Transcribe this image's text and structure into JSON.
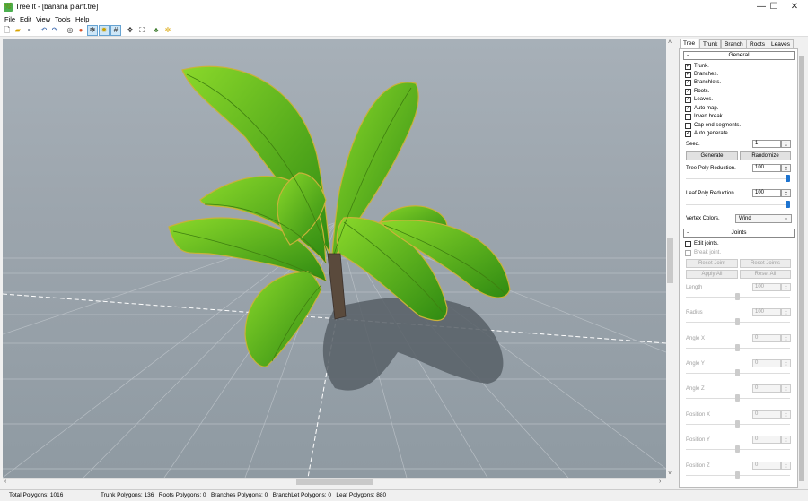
{
  "window": {
    "title": "Tree It - [banana plant.tre]",
    "icon_label": "🌿",
    "minimize": "—",
    "maximize": "☐",
    "close": "✕"
  },
  "menu": [
    "File",
    "Edit",
    "View",
    "Tools",
    "Help"
  ],
  "toolbar": [
    "new-icon",
    "open-icon",
    "save-icon",
    "undo-icon",
    "redo-icon",
    "wireframe-icon",
    "color-icon",
    "texture-icon",
    "light-icon",
    "grid-icon",
    "move-icon",
    "zoom-extents-icon",
    "tree-icon",
    "settings-icon"
  ],
  "tabs": [
    "Tree",
    "Trunk",
    "Branch",
    "Roots",
    "Leaves"
  ],
  "general": {
    "header": "General",
    "toggle": "-",
    "checks": [
      {
        "label": "Trunk.",
        "checked": true
      },
      {
        "label": "Branches.",
        "checked": true
      },
      {
        "label": "Branchlets.",
        "checked": true
      },
      {
        "label": "Roots.",
        "checked": true
      },
      {
        "label": "Leaves.",
        "checked": true
      },
      {
        "label": "Auto map.",
        "checked": true
      },
      {
        "label": "Invert break.",
        "checked": false
      },
      {
        "label": "Cap end segments.",
        "checked": false
      },
      {
        "label": "Auto generate.",
        "checked": true
      }
    ],
    "seed_label": "Seed.",
    "seed_value": "1",
    "generate": "Generate",
    "randomize": "Randomize",
    "tree_poly_label": "Tree Poly Reduction.",
    "tree_poly_value": "100",
    "tree_poly_level": 1.0,
    "leaf_poly_label": "Leaf Poly Reduction.",
    "leaf_poly_value": "100",
    "leaf_poly_level": 1.0,
    "vertex_colors_label": "Vertex Colors.",
    "vertex_colors_value": "Wind"
  },
  "joints": {
    "header": "Joints",
    "toggle": "-",
    "edit_joints": "Edit joints.",
    "break_joint": "Break joint.",
    "reset_joint": "Reset Joint",
    "reset_joints": "Reset Joints",
    "apply_all": "Apply All",
    "reset_all": "Reset All",
    "fields": [
      {
        "label": "Length",
        "value": "100",
        "level": 0.5
      },
      {
        "label": "Radius",
        "value": "100",
        "level": 0.5
      },
      {
        "label": "Angle X",
        "value": "0",
        "level": 0.5
      },
      {
        "label": "Angle Y",
        "value": "0",
        "level": 0.5
      },
      {
        "label": "Angle Z",
        "value": "0",
        "level": 0.5
      },
      {
        "label": "Position X",
        "value": "0",
        "level": 0.5
      },
      {
        "label": "Position Y",
        "value": "0",
        "level": 0.5
      },
      {
        "label": "Position Z",
        "value": "0",
        "level": 0.5
      }
    ]
  },
  "status": {
    "total": "Total Polygons: 1016",
    "detail": "Trunk Polygons: 136   Roots Polygons: 0   Branches Polygons: 0   BranchLet Polygons: 0   Leaf Polygons: 880"
  },
  "colors": {
    "leaf_dark": "#2f8a12",
    "leaf_light": "#7fd21f",
    "trunk": "#5a4a3c",
    "shadow": "#565e65"
  }
}
